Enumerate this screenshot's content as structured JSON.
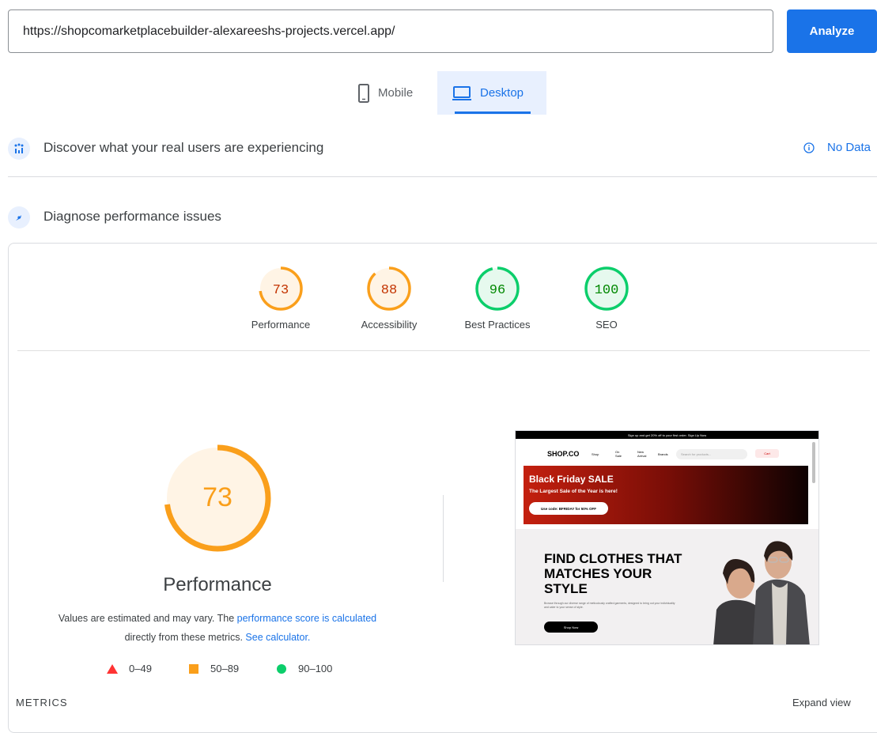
{
  "url_bar": {
    "value": "https://shopcomarketplacebuilder-alexareeshs-projects.vercel.app/",
    "analyze_label": "Analyze"
  },
  "device_tabs": [
    {
      "label": "Mobile",
      "icon": "phone-icon",
      "selected": false
    },
    {
      "label": "Desktop",
      "icon": "laptop-icon",
      "selected": true
    }
  ],
  "field_section": {
    "title": "Discover what your real users are experiencing",
    "status": "No Data",
    "icon": "users-chart-icon"
  },
  "lab_section": {
    "title": "Diagnose performance issues",
    "icon": "diagnose-icon"
  },
  "scores": [
    {
      "label": "Performance",
      "value": "73",
      "score": 73,
      "color": "#fa9f1b"
    },
    {
      "label": "Accessibility",
      "value": "88",
      "score": 88,
      "color": "#fa9f1b"
    },
    {
      "label": "Best Practices",
      "value": "96",
      "score": 96,
      "color": "#0cce6b"
    },
    {
      "label": "SEO",
      "value": "100",
      "score": 100,
      "color": "#0cce6b"
    }
  ],
  "performance_detail": {
    "score": "73",
    "score_value": 73,
    "title": "Performance",
    "desc_part1": "Values are estimated and may vary. The ",
    "desc_link1": "performance score is calculated",
    "desc_part2": " directly from these metrics. ",
    "desc_link2": "See calculator."
  },
  "legend": [
    {
      "range": "0–49",
      "shape": "triangle",
      "color": "#ff3333"
    },
    {
      "range": "50–89",
      "shape": "square",
      "color": "#fa9f1b"
    },
    {
      "range": "90–100",
      "shape": "circle",
      "color": "#0cce6b"
    }
  ],
  "screenshot": {
    "top_bar": "Sign up and get 20% off to your first order. Sign Up Now",
    "logo": "SHOP.CO",
    "nav": [
      "Shop",
      "On Sale",
      "New Arrival",
      "Brands"
    ],
    "search_placeholder": "Search for products...",
    "cart_label": "Cart",
    "banner_title": "Black Friday SALE",
    "banner_subtitle": "The Largest Sale of the Year is here!",
    "banner_button": "Use code: BFRIDAY for 50% OFF",
    "hero_title": "FIND CLOTHES THAT MATCHES YOUR STYLE",
    "hero_text": "Browse through our diverse range of meticulously crafted garments, designed to bring out your individuality and cater to your sense of style.",
    "hero_button": "Shop Now"
  },
  "footer": {
    "metrics_label": "METRICS",
    "expand_label": "Expand view"
  },
  "colors": {
    "accent": "#1a73e8",
    "average": "#fa9f1b",
    "pass": "#0cce6b",
    "fail": "#ff3333"
  }
}
